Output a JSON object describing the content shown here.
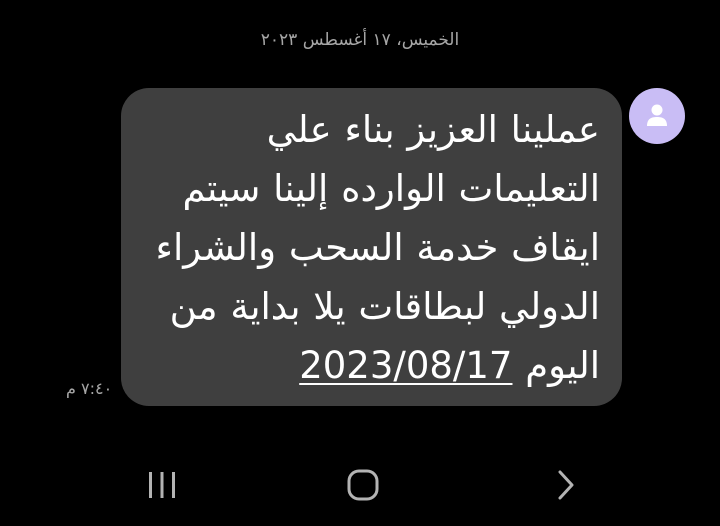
{
  "conversation": {
    "date_header": "الخميس، ١٧ أغسطس ٢٠٢٣",
    "avatar_icon": "person-icon",
    "avatar_color": "#c9bdf5",
    "bubble_color": "#3f3f3f",
    "message": {
      "line1": "عملينا العزيز بناء علي",
      "line2": "التعليمات الوارده إلينا سيتم",
      "line3": "ايقاف خدمة السحب والشراء",
      "line4": "الدولي لبطاقات يلا بداية من",
      "line5_prefix": "اليوم",
      "date_link": "2023/08/17"
    },
    "time": "٧:٤٠ م"
  },
  "navigation_bar": {
    "recents_icon": "recents-icon",
    "home_icon": "home-icon",
    "back_icon": "back-chevron-icon"
  }
}
